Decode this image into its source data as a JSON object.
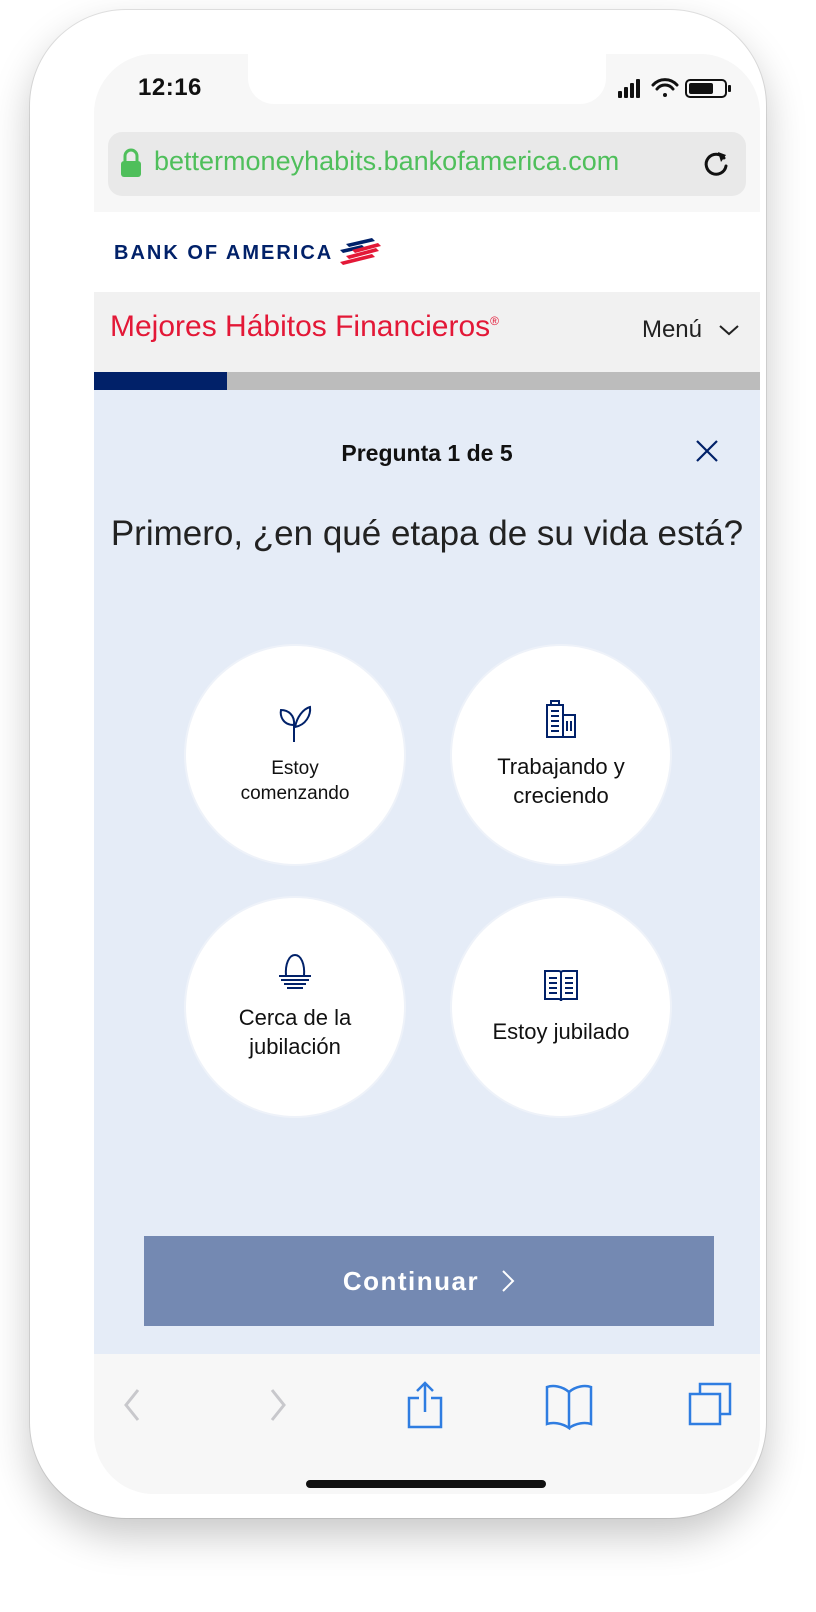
{
  "status_bar": {
    "time": "12:16"
  },
  "browser": {
    "url": "bettermoneyhabits.bankofamerica.com"
  },
  "brand": {
    "name": "BANK OF AMERICA"
  },
  "site_header": {
    "title": "Mejores Hábitos Financieros",
    "registered_mark": "®",
    "menu_label": "Menú"
  },
  "progress": {
    "fraction": 0.2
  },
  "quiz": {
    "counter": "Pregunta 1 de 5",
    "question": "Primero, ¿en qué etapa de su vida está?",
    "options": [
      {
        "line1": "Estoy",
        "line2": "comenzando",
        "icon": "sprout-icon"
      },
      {
        "line1": "Trabajando y",
        "line2": "creciendo",
        "icon": "building-icon"
      },
      {
        "line1": "Cerca de la",
        "line2": "jubilación",
        "icon": "nest-egg-icon"
      },
      {
        "line1": "Estoy jubilado",
        "line2": "",
        "icon": "open-book-icon"
      }
    ],
    "continue_label": "Continuar"
  },
  "colors": {
    "brand_navy": "#012169",
    "brand_red": "#e31837",
    "url_green": "#4fbf5b",
    "quiz_bg": "#e5ecf7",
    "button": "#7489b2",
    "ios_blue": "#2f7de1"
  }
}
